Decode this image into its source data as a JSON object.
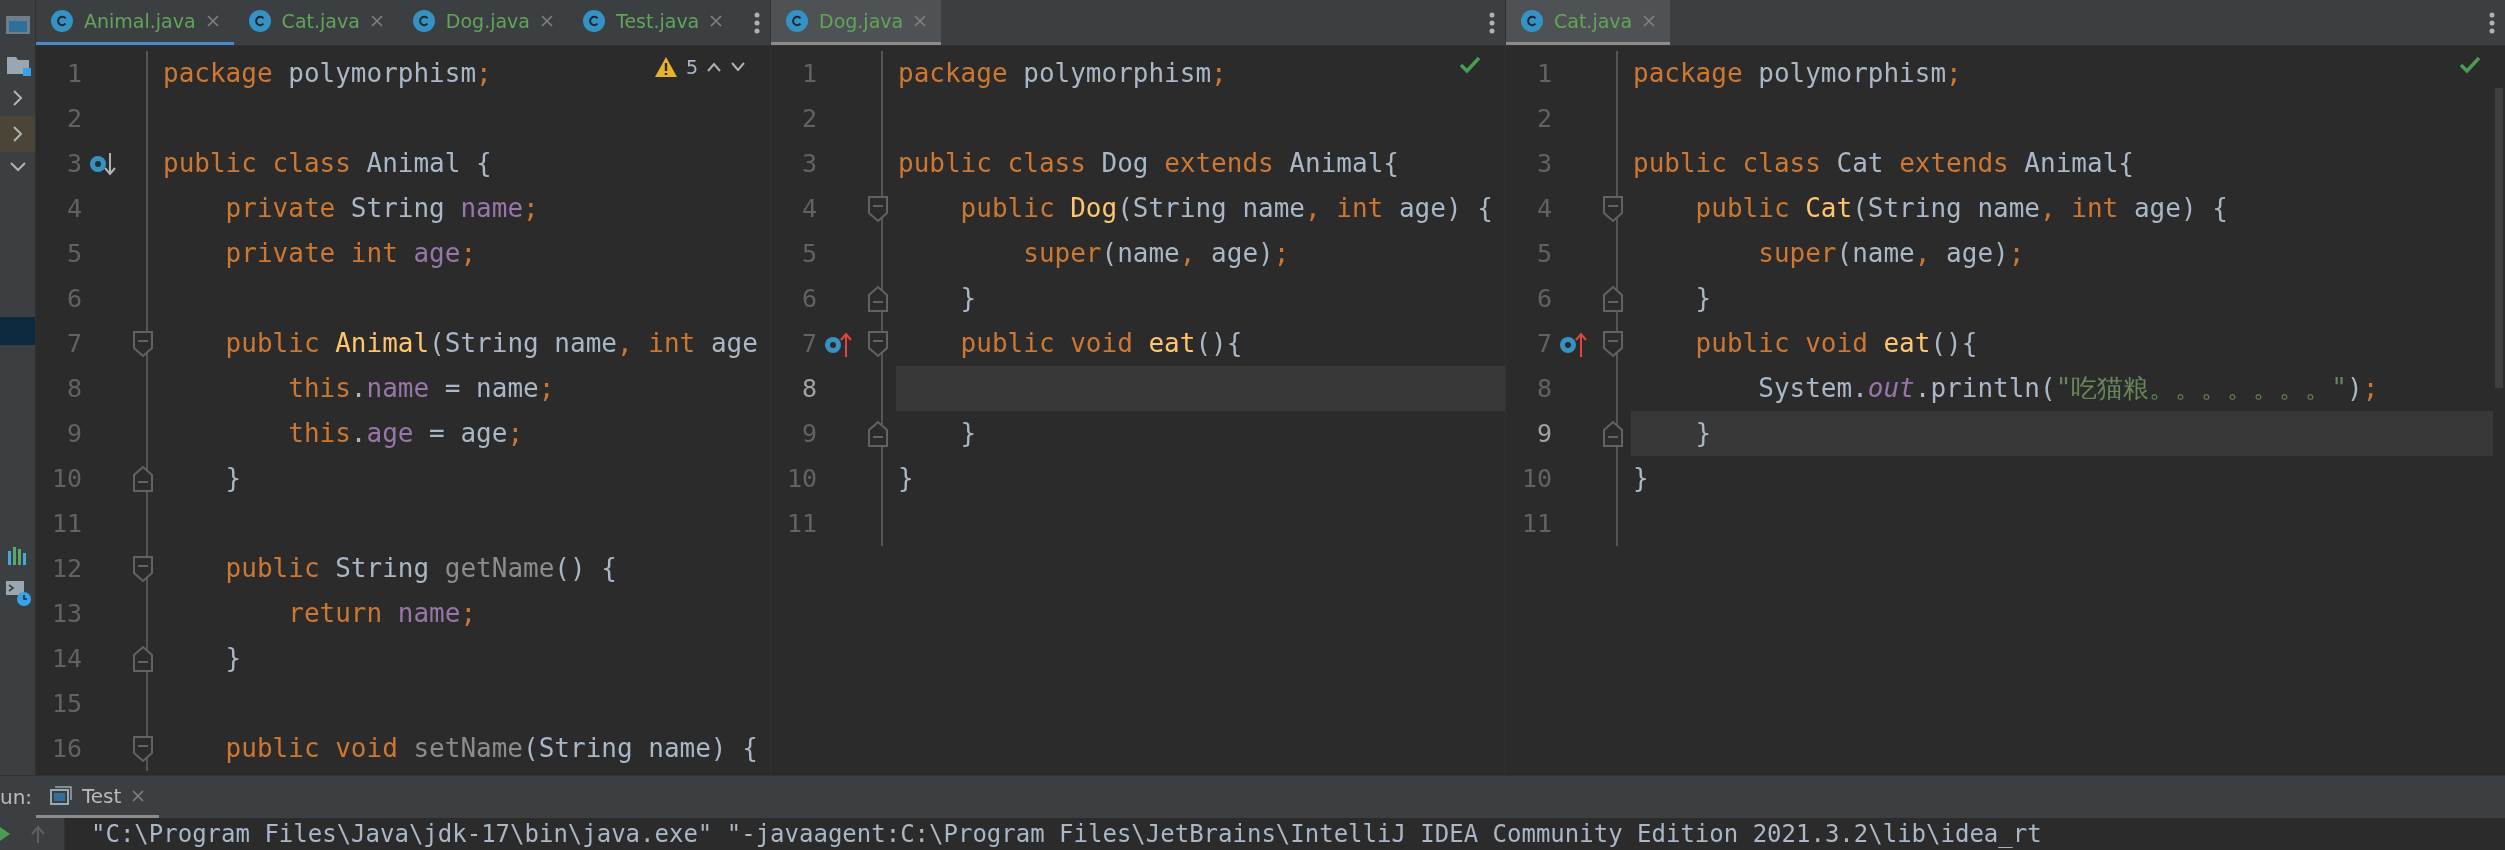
{
  "panes": [
    {
      "focused": true,
      "tabs": [
        {
          "label": "Animal.java",
          "selected": true
        },
        {
          "label": "Cat.java",
          "selected": false
        },
        {
          "label": "Dog.java",
          "selected": false
        },
        {
          "label": "Test.java",
          "selected": false
        }
      ],
      "status": {
        "kind": "warnings",
        "count": "5"
      },
      "lines": [
        {
          "number": "1",
          "current": false,
          "tokens": [
            {
              "kind": "keyword",
              "text": "package"
            },
            {
              "kind": "plain",
              "text": " polymorphism"
            },
            {
              "kind": "keyword",
              "text": ";"
            }
          ]
        },
        {
          "number": "2",
          "current": false
        },
        {
          "number": "3",
          "current": false,
          "marker": {
            "kind": "subclassed"
          },
          "tokens": [
            {
              "kind": "keyword",
              "text": "public class "
            },
            {
              "kind": "plain",
              "text": "Animal {"
            }
          ]
        },
        {
          "number": "4",
          "current": false,
          "tokens": [
            {
              "kind": "keyword",
              "text": "    private "
            },
            {
              "kind": "plain",
              "text": "String "
            },
            {
              "kind": "field",
              "text": "name"
            },
            {
              "kind": "keyword",
              "text": ";"
            }
          ]
        },
        {
          "number": "5",
          "current": false,
          "tokens": [
            {
              "kind": "keyword",
              "text": "    private int "
            },
            {
              "kind": "field",
              "text": "age"
            },
            {
              "kind": "keyword",
              "text": ";"
            }
          ]
        },
        {
          "number": "6",
          "current": false
        },
        {
          "number": "7",
          "current": false,
          "fold": {
            "kind": "start"
          },
          "tokens": [
            {
              "kind": "keyword",
              "text": "    public "
            },
            {
              "kind": "decl",
              "text": "Animal"
            },
            {
              "kind": "plain",
              "text": "(String name"
            },
            {
              "kind": "keyword",
              "text": ", int "
            },
            {
              "kind": "plain",
              "text": "age"
            }
          ]
        },
        {
          "number": "8",
          "current": false,
          "tokens": [
            {
              "kind": "keyword",
              "text": "        this"
            },
            {
              "kind": "plain",
              "text": "."
            },
            {
              "kind": "field",
              "text": "name"
            },
            {
              "kind": "plain",
              "text": " = name"
            },
            {
              "kind": "keyword",
              "text": ";"
            }
          ]
        },
        {
          "number": "9",
          "current": false,
          "tokens": [
            {
              "kind": "keyword",
              "text": "        this"
            },
            {
              "kind": "plain",
              "text": "."
            },
            {
              "kind": "field",
              "text": "age"
            },
            {
              "kind": "plain",
              "text": " = age"
            },
            {
              "kind": "keyword",
              "text": ";"
            }
          ]
        },
        {
          "number": "10",
          "current": false,
          "fold": {
            "kind": "end"
          },
          "tokens": [
            {
              "kind": "plain",
              "text": "    }"
            }
          ]
        },
        {
          "number": "11",
          "current": false
        },
        {
          "number": "12",
          "current": false,
          "fold": {
            "kind": "start"
          },
          "tokens": [
            {
              "kind": "keyword",
              "text": "    public "
            },
            {
              "kind": "plain",
              "text": "String "
            },
            {
              "kind": "unused",
              "text": "getName"
            },
            {
              "kind": "plain",
              "text": "() {"
            }
          ]
        },
        {
          "number": "13",
          "current": false,
          "tokens": [
            {
              "kind": "keyword",
              "text": "        return "
            },
            {
              "kind": "field",
              "text": "name"
            },
            {
              "kind": "keyword",
              "text": ";"
            }
          ]
        },
        {
          "number": "14",
          "current": false,
          "fold": {
            "kind": "end"
          },
          "tokens": [
            {
              "kind": "plain",
              "text": "    }"
            }
          ]
        },
        {
          "number": "15",
          "current": false
        },
        {
          "number": "16",
          "current": false,
          "fold": {
            "kind": "start"
          },
          "tokens": [
            {
              "kind": "keyword",
              "text": "    public void "
            },
            {
              "kind": "unused",
              "text": "setName"
            },
            {
              "kind": "plain",
              "text": "(String name) {"
            }
          ]
        }
      ]
    },
    {
      "focused": false,
      "tabs": [
        {
          "label": "Dog.java",
          "selected": true
        }
      ],
      "status": {
        "kind": "ok"
      },
      "lines": [
        {
          "number": "1",
          "current": false,
          "tokens": [
            {
              "kind": "keyword",
              "text": "package"
            },
            {
              "kind": "plain",
              "text": " polymorphism"
            },
            {
              "kind": "keyword",
              "text": ";"
            }
          ]
        },
        {
          "number": "2",
          "current": false
        },
        {
          "number": "3",
          "current": false,
          "tokens": [
            {
              "kind": "keyword",
              "text": "public class "
            },
            {
              "kind": "plain",
              "text": "Dog "
            },
            {
              "kind": "keyword",
              "text": "extends "
            },
            {
              "kind": "plain",
              "text": "Animal{"
            }
          ]
        },
        {
          "number": "4",
          "current": false,
          "fold": {
            "kind": "start"
          },
          "tokens": [
            {
              "kind": "keyword",
              "text": "    public "
            },
            {
              "kind": "decl",
              "text": "Dog"
            },
            {
              "kind": "plain",
              "text": "(String name"
            },
            {
              "kind": "keyword",
              "text": ", int "
            },
            {
              "kind": "plain",
              "text": "age) {"
            }
          ]
        },
        {
          "number": "5",
          "current": false,
          "tokens": [
            {
              "kind": "keyword",
              "text": "        super"
            },
            {
              "kind": "plain",
              "text": "(name"
            },
            {
              "kind": "keyword",
              "text": ", "
            },
            {
              "kind": "plain",
              "text": "age)"
            },
            {
              "kind": "keyword",
              "text": ";"
            }
          ]
        },
        {
          "number": "6",
          "current": false,
          "fold": {
            "kind": "end"
          },
          "tokens": [
            {
              "kind": "plain",
              "text": "    }"
            }
          ]
        },
        {
          "number": "7",
          "current": false,
          "marker": {
            "kind": "overrides"
          },
          "fold": {
            "kind": "start"
          },
          "tokens": [
            {
              "kind": "keyword",
              "text": "    public void "
            },
            {
              "kind": "decl",
              "text": "eat"
            },
            {
              "kind": "plain",
              "text": "(){"
            }
          ]
        },
        {
          "number": "8",
          "current": true
        },
        {
          "number": "9",
          "current": false,
          "fold": {
            "kind": "end"
          },
          "tokens": [
            {
              "kind": "plain",
              "text": "    }"
            }
          ]
        },
        {
          "number": "10",
          "current": false,
          "tokens": [
            {
              "kind": "plain",
              "text": "}"
            }
          ]
        },
        {
          "number": "11",
          "current": false
        }
      ]
    },
    {
      "focused": false,
      "tabs": [
        {
          "label": "Cat.java",
          "selected": true
        }
      ],
      "status": {
        "kind": "ok"
      },
      "lines": [
        {
          "number": "1",
          "current": false,
          "tokens": [
            {
              "kind": "keyword",
              "text": "package"
            },
            {
              "kind": "plain",
              "text": " polymorphism"
            },
            {
              "kind": "keyword",
              "text": ";"
            }
          ]
        },
        {
          "number": "2",
          "current": false
        },
        {
          "number": "3",
          "current": false,
          "tokens": [
            {
              "kind": "keyword",
              "text": "public class "
            },
            {
              "kind": "plain",
              "text": "Cat "
            },
            {
              "kind": "keyword",
              "text": "extends "
            },
            {
              "kind": "plain",
              "text": "Animal{"
            }
          ]
        },
        {
          "number": "4",
          "current": false,
          "fold": {
            "kind": "start"
          },
          "tokens": [
            {
              "kind": "keyword",
              "text": "    public "
            },
            {
              "kind": "decl",
              "text": "Cat"
            },
            {
              "kind": "plain",
              "text": "(String name"
            },
            {
              "kind": "keyword",
              "text": ", int "
            },
            {
              "kind": "plain",
              "text": "age) {"
            }
          ]
        },
        {
          "number": "5",
          "current": false,
          "tokens": [
            {
              "kind": "keyword",
              "text": "        super"
            },
            {
              "kind": "plain",
              "text": "(name"
            },
            {
              "kind": "keyword",
              "text": ", "
            },
            {
              "kind": "plain",
              "text": "age)"
            },
            {
              "kind": "keyword",
              "text": ";"
            }
          ]
        },
        {
          "number": "6",
          "current": false,
          "fold": {
            "kind": "end"
          },
          "tokens": [
            {
              "kind": "plain",
              "text": "    }"
            }
          ]
        },
        {
          "number": "7",
          "current": false,
          "marker": {
            "kind": "overrides"
          },
          "fold": {
            "kind": "start"
          },
          "tokens": [
            {
              "kind": "keyword",
              "text": "    public void "
            },
            {
              "kind": "decl",
              "text": "eat"
            },
            {
              "kind": "plain",
              "text": "(){"
            }
          ]
        },
        {
          "number": "8",
          "current": false,
          "tokens": [
            {
              "kind": "plain",
              "text": "        System."
            },
            {
              "kind": "static",
              "text": "out"
            },
            {
              "kind": "plain",
              "text": ".println("
            },
            {
              "kind": "string",
              "text": "\"吃猫粮。。。。。。。\""
            },
            {
              "kind": "plain",
              "text": ")"
            },
            {
              "kind": "keyword",
              "text": ";"
            }
          ]
        },
        {
          "number": "9",
          "current": true,
          "fold": {
            "kind": "end"
          },
          "tokens": [
            {
              "kind": "plain",
              "text": "    }"
            }
          ]
        },
        {
          "number": "10",
          "current": false,
          "tokens": [
            {
              "kind": "plain",
              "text": "}"
            }
          ]
        },
        {
          "number": "11",
          "current": false
        }
      ]
    }
  ],
  "run_panel": {
    "label": "un:",
    "tabs": [
      {
        "label": "Test",
        "selected": true
      }
    ],
    "console_line": "\"C:\\Program Files\\Java\\jdk-17\\bin\\java.exe\" \"-javaagent:C:\\Program Files\\JetBrains\\IntelliJ IDEA Community Edition 2021.3.2\\lib\\idea_rt"
  }
}
